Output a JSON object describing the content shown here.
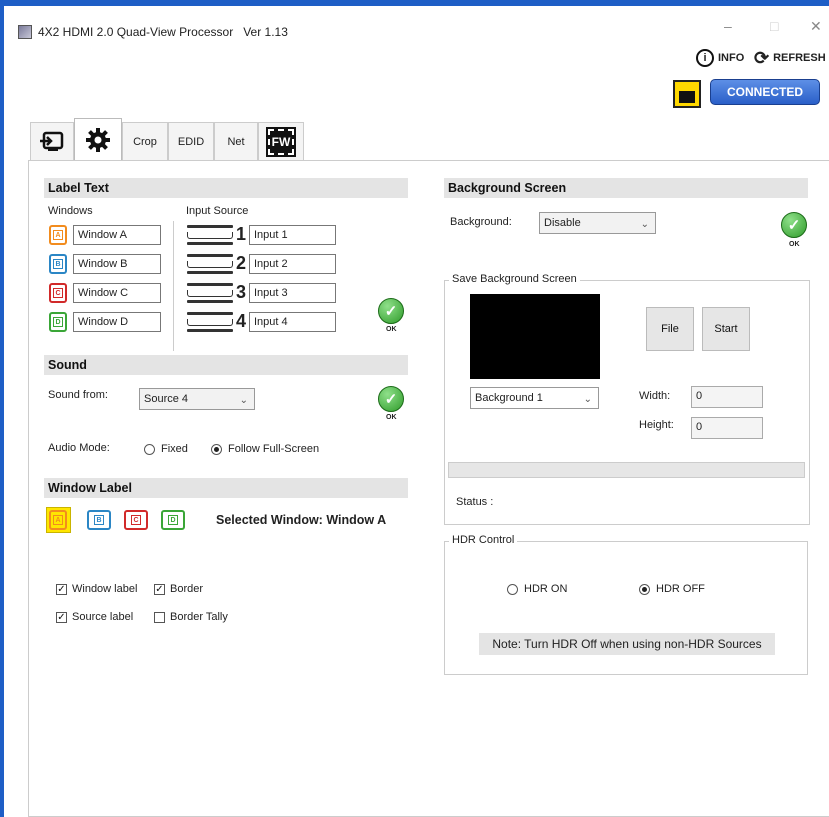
{
  "window": {
    "title": "4X2 HDMI 2.0 Quad-View Processor",
    "version": "Ver 1.13",
    "minimize": "–",
    "maximize": "□",
    "close": "✕"
  },
  "header": {
    "info_label": "INFO",
    "info_icon": "i",
    "refresh_label": "REFRESH",
    "refresh_icon": "⟳",
    "connected_label": "CONNECTED",
    "colors": {
      "accent": "#2a5fc8",
      "connection_icon_bg": "#ffd800",
      "frame": "#1e5ec6"
    }
  },
  "tabs": [
    {
      "label": "",
      "icon": "input-icon"
    },
    {
      "label": "",
      "icon": "gear-icon",
      "active": true
    },
    {
      "label": "Crop"
    },
    {
      "label": "EDID"
    },
    {
      "label": "Net"
    },
    {
      "label": "FW",
      "icon": "firmware-chip-icon"
    }
  ],
  "label_text": {
    "title": "Label Text",
    "windows_header": "Windows",
    "input_source_header": "Input Source",
    "windows": [
      {
        "icon_letter": "A",
        "value": "Window A",
        "color": "#f28c1e"
      },
      {
        "icon_letter": "B",
        "value": "Window B",
        "color": "#2b86c5"
      },
      {
        "icon_letter": "C",
        "value": "Window C",
        "color": "#d12a2a"
      },
      {
        "icon_letter": "D",
        "value": "Window D",
        "color": "#3aa637"
      }
    ],
    "inputs": [
      {
        "number": "1",
        "value": "Input 1"
      },
      {
        "number": "2",
        "value": "Input 2"
      },
      {
        "number": "3",
        "value": "Input 3"
      },
      {
        "number": "4",
        "value": "Input 4"
      }
    ],
    "ok_label": "OK"
  },
  "sound": {
    "title": "Sound",
    "sound_from_label": "Sound from:",
    "sound_from_value": "Source 4",
    "ok_label": "OK",
    "audio_mode_label": "Audio Mode:",
    "mode_fixed": "Fixed",
    "mode_follow": "Follow Full-Screen",
    "selected_mode": "Follow Full-Screen"
  },
  "window_label": {
    "title": "Window Label",
    "icons": [
      {
        "letter": "A",
        "color": "#f28c1e",
        "selected": true
      },
      {
        "letter": "B",
        "color": "#2b86c5"
      },
      {
        "letter": "C",
        "color": "#d12a2a"
      },
      {
        "letter": "D",
        "color": "#3aa637"
      }
    ],
    "selected_text": "Selected Window: Window A",
    "checkbox_window_label": "Window label",
    "checkbox_border": "Border",
    "checkbox_source_label": "Source label",
    "checkbox_border_tally": "Border Tally",
    "checked": {
      "window_label": true,
      "border": true,
      "source_label": true,
      "border_tally": false
    },
    "check_mark": "✓"
  },
  "background": {
    "title": "Background Screen",
    "background_label": "Background:",
    "background_value": "Disable",
    "ok_label": "OK",
    "save_group_title": "Save Background Screen",
    "file_button": "File",
    "start_button": "Start",
    "background_select": "Background 1",
    "width_label": "Width:",
    "width_value": "0",
    "height_label": "Height:",
    "height_value": "0",
    "status_label": "Status :",
    "progress": 0
  },
  "hdr": {
    "group_title": "HDR Control",
    "on_label": "HDR ON",
    "off_label": "HDR OFF",
    "selected": "HDR OFF",
    "note": "Note: Turn HDR Off when using non-HDR Sources"
  }
}
